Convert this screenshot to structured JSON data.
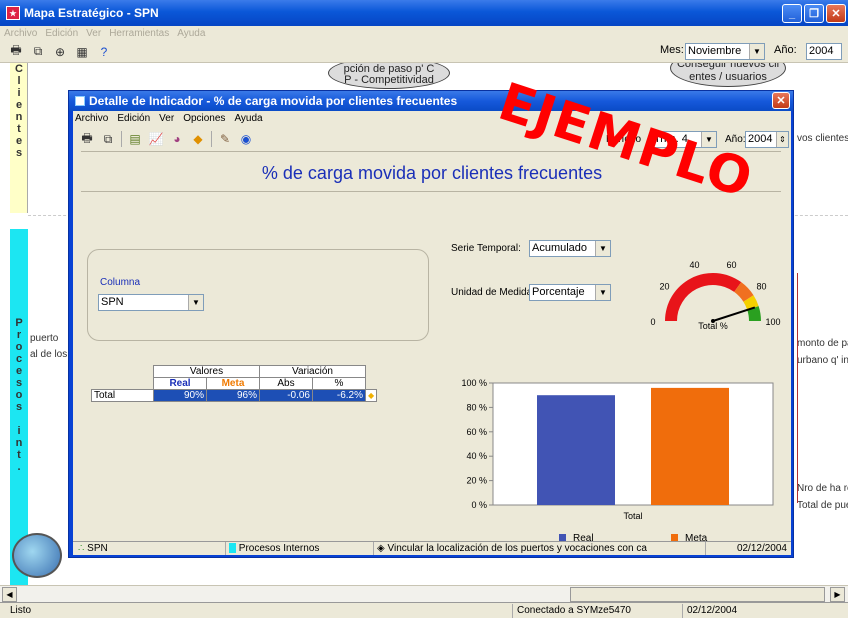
{
  "outer": {
    "title": "Mapa Estratégico - SPN",
    "menu": [
      "Archivo",
      "Edición",
      "Ver",
      "Herramientas",
      "Ayuda"
    ],
    "mes_label": "Mes:",
    "mes_value": "Noviembre",
    "anio_label": "Año:",
    "anio_value": "2004"
  },
  "map": {
    "lane1_letters": [
      "C",
      "l",
      "i",
      "e",
      "n",
      "t",
      "e",
      "s"
    ],
    "lane2_letters": [
      "P",
      "r",
      "o",
      "c",
      "e",
      "s",
      "o",
      "s",
      "",
      "i",
      "n",
      "t",
      "."
    ],
    "bubble1": "pción de paso p' C\nP - Competitividad",
    "bubble2": "Conseguir nuevos cli\nentes / usuarios",
    "text_left1": "puerto",
    "text_left2": "al de los pi",
    "text_right1": "vos clientes",
    "text_right2": "monto de par",
    "text_right3": "urbano q' int",
    "text_right4": "Nro de ha rec",
    "text_right5": "Total de puer"
  },
  "statusbar": {
    "ready": "Listo",
    "connection": "Conectado a SYMze5470",
    "date": "02/12/2004"
  },
  "dialog": {
    "title": "Detalle de Indicador - % de carga movida por clientes frecuentes",
    "menu": [
      "Archivo",
      "Edición",
      "Ver",
      "Opciones",
      "Ayuda"
    ],
    "periodo_label": "Período",
    "periodo_value": "Trim. 4",
    "anio_label": "Año:",
    "anio_value": "2004",
    "heading": "% de carga movida por clientes frecuentes",
    "columna_label": "Columna",
    "columna_value": "SPN",
    "serie_label": "Serie Temporal:",
    "serie_value": "Acumulado",
    "unidad_label": "Unidad de Medida:",
    "unidad_value": "Porcentaje",
    "gauge": {
      "labels": [
        "0",
        "20",
        "40",
        "60",
        "80",
        "100"
      ],
      "center_label": "Total %",
      "value": 90
    },
    "table": {
      "group_valores": "Valores",
      "group_variacion": "Variación",
      "col_real": "Real",
      "col_meta": "Meta",
      "col_abs": "Abs",
      "col_pct": "%",
      "row_label": "Total",
      "real": "90%",
      "meta": "96%",
      "abs": "-0.06",
      "pct": "-6.2%"
    },
    "status": {
      "org": "SPN",
      "perspective": "Procesos Internos",
      "objective": "Vincular la localización de los puertos y vocaciones con ca",
      "date": "02/12/2004"
    }
  },
  "watermark": "EJEMPLO",
  "colors": {
    "real": "#4154b4",
    "meta": "#f06d0c",
    "heading": "#1a2fb8"
  },
  "chart_data": {
    "type": "bar",
    "categories": [
      "Total"
    ],
    "series": [
      {
        "name": "Real",
        "values": [
          90
        ]
      },
      {
        "name": "Meta",
        "values": [
          96
        ]
      }
    ],
    "yticks": [
      "0 %",
      "20 %",
      "40 %",
      "60 %",
      "80 %",
      "100 %"
    ],
    "ylim": [
      0,
      100
    ],
    "legend": "bottom"
  }
}
